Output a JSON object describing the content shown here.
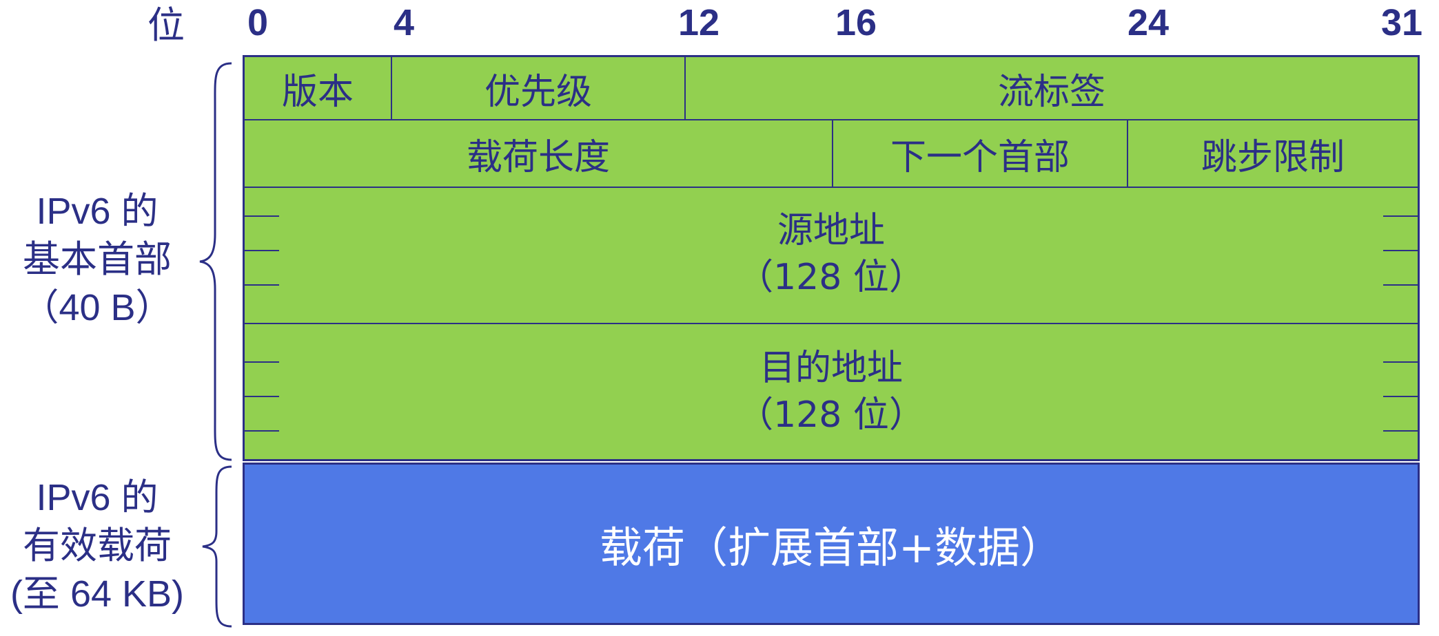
{
  "bit_axis": {
    "label": "位",
    "ticks": [
      "0",
      "4",
      "12",
      "16",
      "24",
      "31"
    ]
  },
  "header": {
    "row1": {
      "version": "版本",
      "priority": "优先级",
      "flow_label": "流标签"
    },
    "row2": {
      "payload_length": "载荷长度",
      "next_header": "下一个首部",
      "hop_limit": "跳步限制"
    },
    "source": {
      "name": "源地址",
      "size": "（128 位）"
    },
    "destination": {
      "name": "目的地址",
      "size": "（128 位）"
    }
  },
  "payload": {
    "label": "载荷（扩展首部+数据）"
  },
  "side_labels": {
    "base_header": [
      "IPv6 的",
      "基本首部",
      "（40 B）"
    ],
    "payload": [
      "IPv6 的",
      "有效载荷",
      "(至 64 KB)"
    ]
  },
  "colors": {
    "header_fill": "#92d050",
    "payload_fill": "#4f79e6",
    "text": "#2b2f86"
  }
}
